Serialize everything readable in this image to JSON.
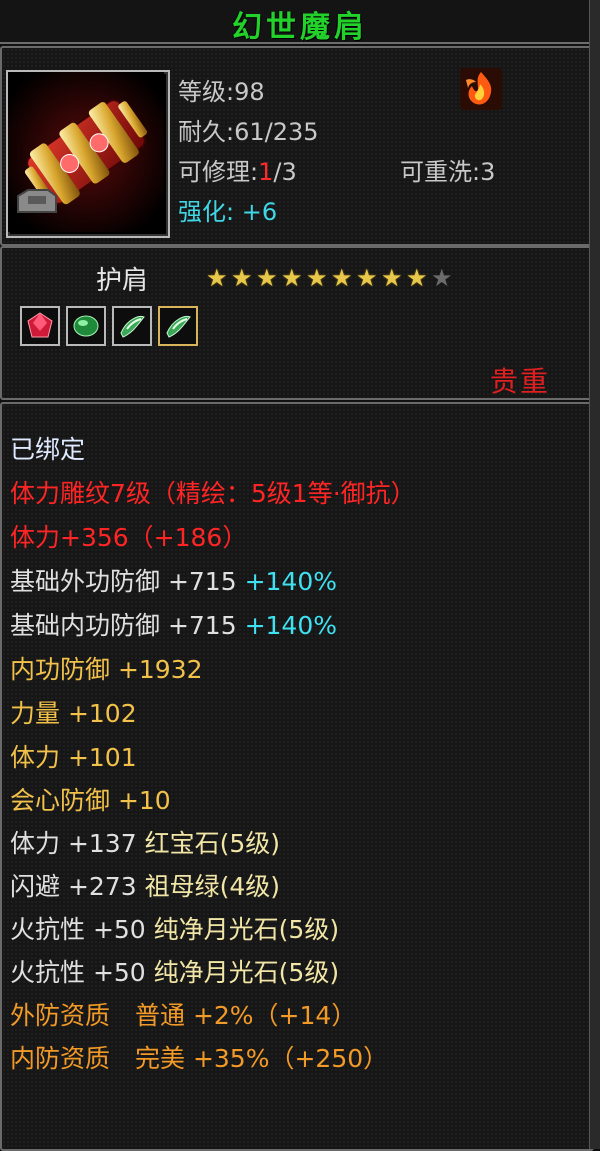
{
  "item": {
    "title": "幻世魔肩",
    "level": "等级:98",
    "durability": "耐久:61/235",
    "repair_prefix": "可修理:",
    "repair_current": "1",
    "repair_suffix": "/3",
    "rewash": "可重洗:3",
    "enhance_label": "强化:",
    "enhance_value": "+6",
    "slot_name": "护肩",
    "stars_filled": 9,
    "stars_total": 10,
    "valuable_label": "贵重",
    "gems": [
      "ruby-gem-icon",
      "emerald-gem-icon",
      "moonstone-gem-icon",
      "moonstone-gem-icon"
    ]
  },
  "attributes": {
    "bound": "已绑定",
    "carve": "体力雕纹7级（精绘：5级1等·御抗）",
    "carve_stat": "体力+356（+186）",
    "base_outer_def": "基础外功防御 +715",
    "base_outer_def_pct": "+140%",
    "base_inner_def": "基础内功防御 +715",
    "base_inner_def_pct": "+140%",
    "inner_def": "内功防御 +1932",
    "strength": "力量 +102",
    "stamina": "体力 +101",
    "crit_def": "会心防御 +10",
    "gem1_stat": "体力 +137",
    "gem1_name": "红宝石(5级)",
    "gem2_stat": "闪避 +273",
    "gem2_name": "祖母绿(4级)",
    "gem3_stat": "火抗性 +50",
    "gem3_name": "纯净月光石(5级)",
    "gem4_stat": "火抗性 +50",
    "gem4_name": "纯净月光石(5级)",
    "outer_quality": "外防资质　普通 +2%（+14）",
    "inner_quality": "内防资质　完美 +35%（+250）"
  }
}
